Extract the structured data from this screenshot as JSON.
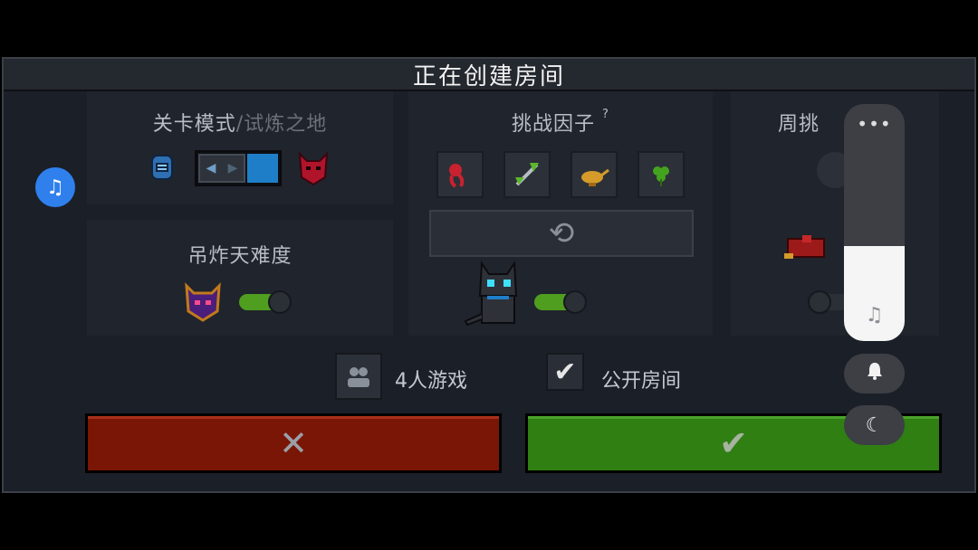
{
  "title": "正在创建房间",
  "level_mode": {
    "heading_main": "关卡模式",
    "heading_sep": "/",
    "heading_sub": "试炼之地",
    "left_icon": "knight-helmet-icon",
    "right_icon": "demon-mask-icon"
  },
  "difficulty": {
    "heading": "吊炸天难度",
    "icon": "purple-demon-icon",
    "enabled": true
  },
  "challenge": {
    "heading": "挑战因子",
    "help_glyph": "?",
    "factors": [
      "red-tentacle-icon",
      "green-sword-icon",
      "magic-lamp-icon",
      "clover-icon"
    ],
    "refresh_icon": "refresh-icon",
    "pet_icon": "black-cat-icon",
    "enabled": true
  },
  "weekly": {
    "heading": "周挑",
    "icon_top": "lightbulb-icon",
    "icon_bottom": "red-chest-icon"
  },
  "options": {
    "players_label": "4人游戏",
    "public_label": "公开房间",
    "public_checked": true
  },
  "buttons": {
    "cancel_glyph": "✕",
    "confirm_glyph": "✔"
  },
  "overlay": {
    "more_glyph": "•••",
    "volume_level": 0.4,
    "music_glyph": "♫",
    "bell_glyph": "🔔",
    "moon_glyph": "☾"
  },
  "colors": {
    "cancel": "#7a1606",
    "confirm": "#2f7f13",
    "toggle_on": "#4f9e1f",
    "accent_blue": "#2f80ed"
  }
}
